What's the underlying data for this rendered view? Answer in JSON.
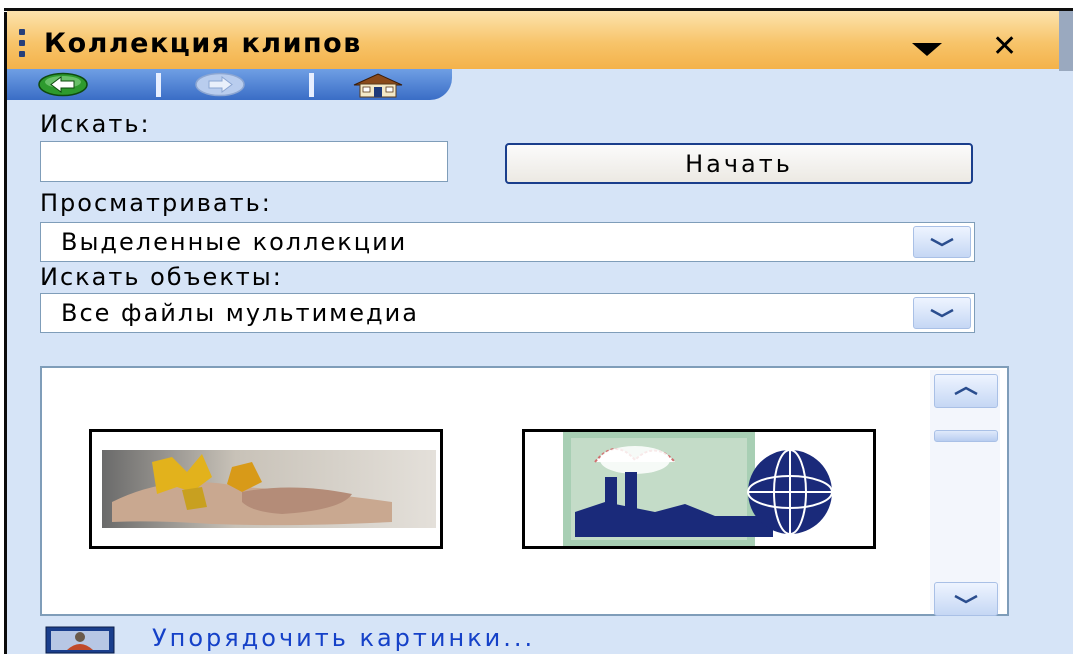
{
  "pane": {
    "title": "Коллекция клипов"
  },
  "nav": {
    "back_icon": "back-arrow-icon",
    "forward_icon": "forward-arrow-icon",
    "home_icon": "home-icon"
  },
  "search": {
    "label": "Искать:",
    "value": "",
    "button_label": "Начать"
  },
  "browse": {
    "label": "Просматривать:",
    "selected": "Выделенные коллекции"
  },
  "object_type": {
    "label": "Искать объекты:",
    "selected": "Все файлы мультимедиа"
  },
  "results": {
    "items": [
      {
        "icon": "hands-leaves-clip"
      },
      {
        "icon": "factory-globe-clip"
      }
    ]
  },
  "footer": {
    "organize_link": "Упорядочить картинки..."
  },
  "colors": {
    "title_bar": "#f7c46a",
    "pane_background": "#d6e4f7",
    "nav_bar": "#3a6dc6",
    "link": "#1541c8"
  }
}
